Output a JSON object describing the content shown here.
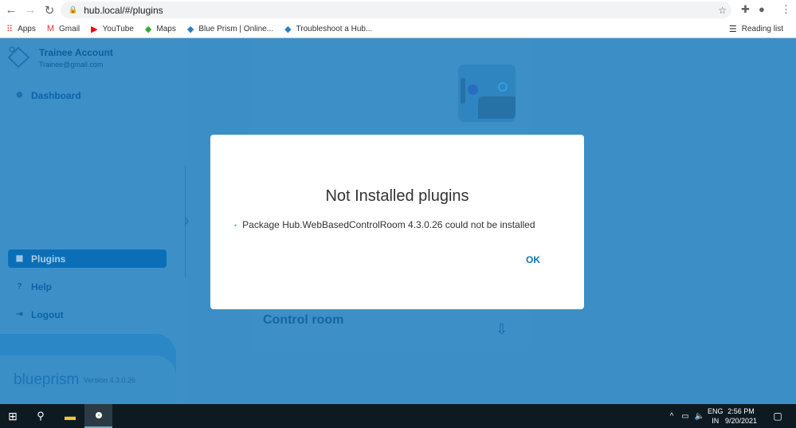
{
  "browser": {
    "url": "hub.local/#/plugins",
    "reading_list": "Reading list",
    "bookmarks": [
      {
        "label": "Apps",
        "icon": "apps-grid-icon"
      },
      {
        "label": "Gmail",
        "icon": "gmail-icon"
      },
      {
        "label": "YouTube",
        "icon": "youtube-icon"
      },
      {
        "label": "Maps",
        "icon": "maps-icon"
      },
      {
        "label": "Blue Prism | Online...",
        "icon": "blueprism-icon"
      },
      {
        "label": "Troubleshoot a Hub...",
        "icon": "blueprism-icon"
      }
    ]
  },
  "sidebar": {
    "account_name": "Trainee Account",
    "account_email": "Trainee@gmail.com",
    "items": [
      {
        "label": "Dashboard"
      },
      {
        "label": "Plugins"
      },
      {
        "label": "Help"
      },
      {
        "label": "Logout"
      }
    ],
    "brand": "blueprism",
    "version": "Version 4.3.0.26"
  },
  "main": {
    "card_title": "Control room"
  },
  "dialog": {
    "title": "Not Installed plugins",
    "messages": [
      "Package Hub.WebBasedControlRoom 4.3.0.26 could not be installed"
    ],
    "ok_label": "OK"
  },
  "taskbar": {
    "lang1": "ENG",
    "lang2": "IN",
    "time": "2:56 PM",
    "date": "9/20/2021"
  }
}
